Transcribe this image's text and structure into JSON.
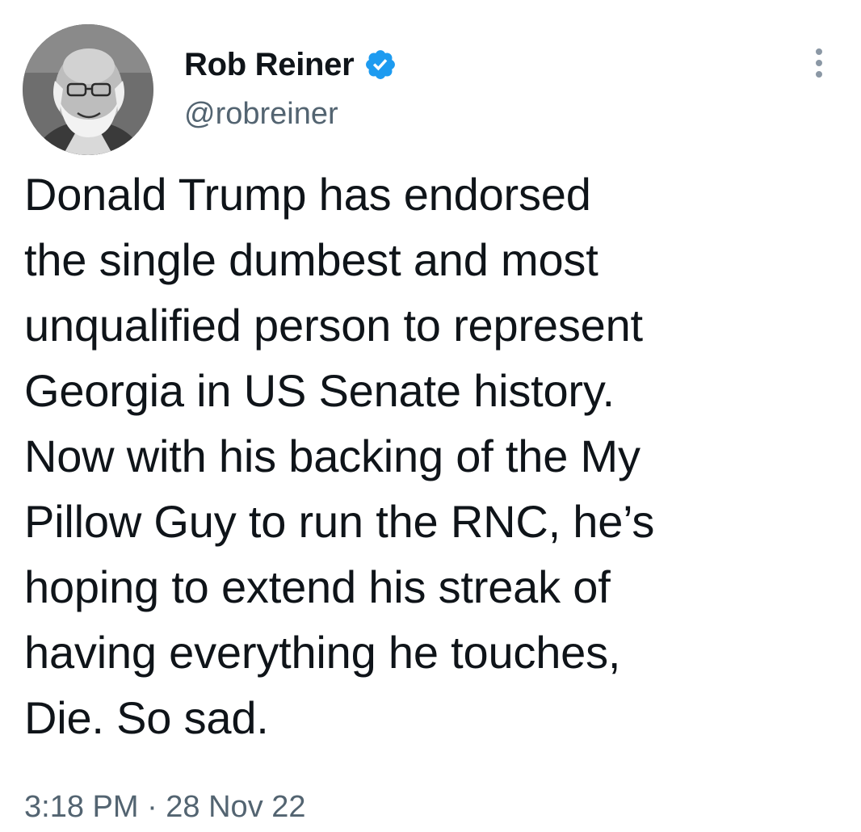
{
  "tweet": {
    "author": {
      "display_name": "Rob Reiner",
      "handle": "@robreiner",
      "verified": true,
      "verified_icon": "verified-badge-icon",
      "verified_color": "#1d9bf0"
    },
    "more_icon": "more-options-icon",
    "text_lines": [
      "Donald Trump has endorsed",
      "the single dumbest and most",
      "unqualified person to represent",
      "Georgia in US Senate history.",
      "Now with his backing of the My",
      "Pillow Guy to run the RNC, he’s",
      "hoping to extend his streak of",
      "having everything he touches,",
      "Die. So sad."
    ],
    "timestamp": "3:18 PM · 28 Nov 22"
  }
}
